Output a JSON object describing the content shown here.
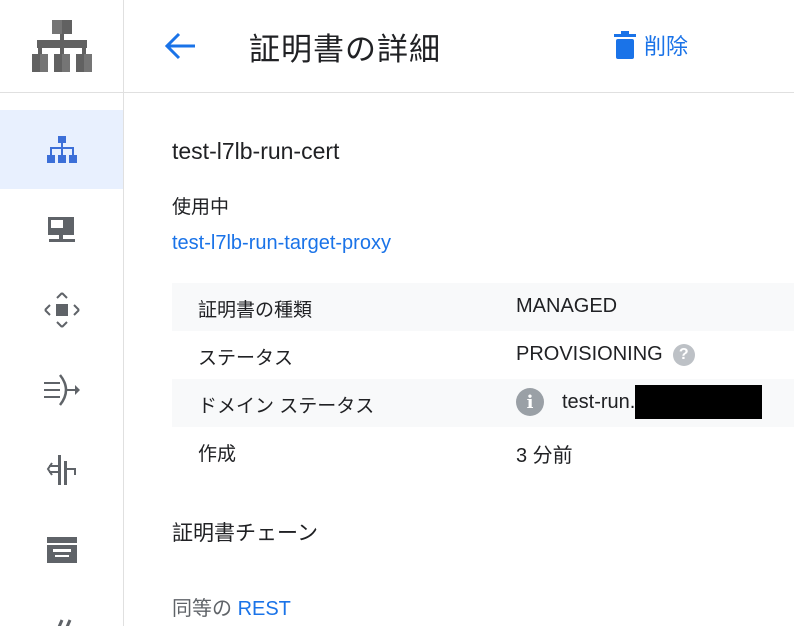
{
  "header": {
    "title": "証明書の詳細",
    "delete_label": "削除"
  },
  "rail": {
    "items": [
      {
        "icon": "load-balancing-icon",
        "active": true
      },
      {
        "icon": "vm-instance-icon",
        "active": false
      },
      {
        "icon": "network-move-icon",
        "active": false
      },
      {
        "icon": "traffic-routing-icon",
        "active": false
      },
      {
        "icon": "route-split-icon",
        "active": false
      },
      {
        "icon": "storage-box-icon",
        "active": false
      }
    ]
  },
  "certificate": {
    "name": "test-l7lb-run-cert",
    "in_use_label": "使用中",
    "in_use_link": "test-l7lb-run-target-proxy"
  },
  "properties": [
    {
      "key": "証明書の種類",
      "value": "MANAGED"
    },
    {
      "key": "ステータス",
      "value": "PROVISIONING"
    },
    {
      "key": "ドメイン ステータス",
      "value": "test-run."
    },
    {
      "key": "作成",
      "value": "3 分前"
    }
  ],
  "chain": {
    "title": "証明書チェーン"
  },
  "equivalent": {
    "prefix": "同等の",
    "link": "REST"
  },
  "colors": {
    "accent": "#1a73e8",
    "icon_blue": "#3c6fd8",
    "icon_gray": "#5f6368",
    "active_bg": "#e8f0fe"
  }
}
